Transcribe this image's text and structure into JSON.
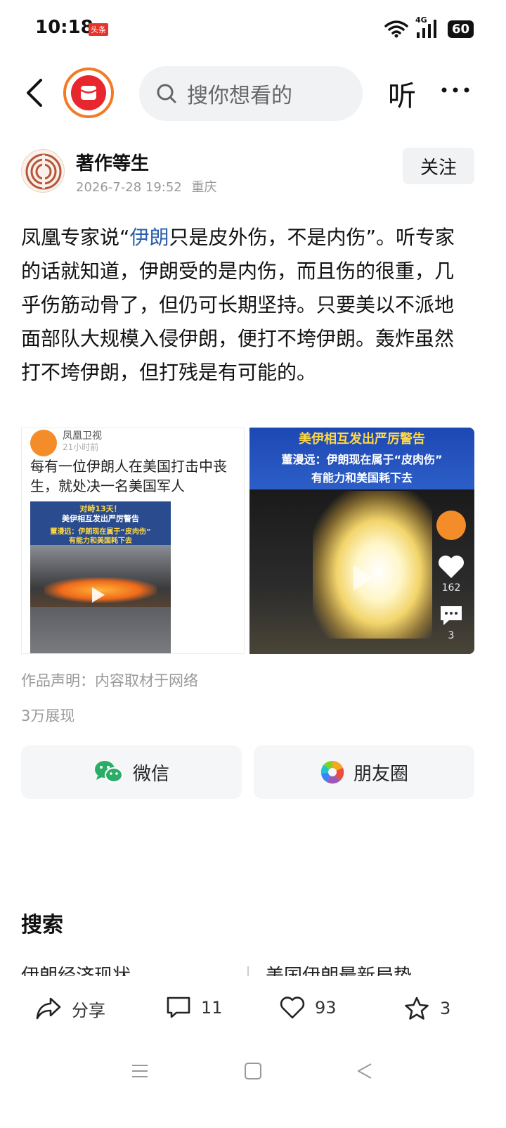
{
  "status_bar": {
    "time": "10:18",
    "app_badge": "头条",
    "network": "4G",
    "battery": "60"
  },
  "top_bar": {
    "search_placeholder": "搜你想看的",
    "listen_label": "听"
  },
  "author": {
    "name": "著作等生",
    "date": "2026-7-28 19:52",
    "location": "重庆",
    "follow_label": "关注"
  },
  "article": {
    "text_before": "凤凰专家说“",
    "keyword": "伊朗",
    "text_after": "只是皮外伤，不是内伤”。听专家的话就知道，伊朗受的是内伤，而且伤的很重，几乎伤筋动骨了，但仍可长期坚持。只要美以不派地面部队大规模入侵伊朗，便打不垮伊朗。轰炸虽然打不垮伊朗，但打残是有可能的。"
  },
  "image_left": {
    "source": "凤凰卫视",
    "time": "21小时前",
    "text": "每有一位伊朗人在美国打击中丧生，就处决一名美国军人",
    "video_line1": "对峙13天！",
    "video_line2": "美伊相互发出严厉警告",
    "video_line3": "董漫远：伊朗现在属于“皮肉伤”",
    "video_line4": "有能力和美国耗下去"
  },
  "image_right": {
    "title": "美伊相互发出严厉警告",
    "line1": "董漫远：伊朗现在属于“皮肉伤”",
    "line2": "有能力和美国耗下去",
    "likes": "162",
    "comments": "3"
  },
  "declaration": "作品声明：内容取材于网络",
  "views": "3万展现",
  "share": {
    "wechat": "微信",
    "moments": "朋友圈"
  },
  "search_section": {
    "title": "搜索",
    "suggestions": [
      "伊朗经济现状",
      "美国伊朗最新局势"
    ]
  },
  "actions": {
    "share": "分享",
    "comments": "11",
    "likes": "93",
    "favorites": "3"
  }
}
